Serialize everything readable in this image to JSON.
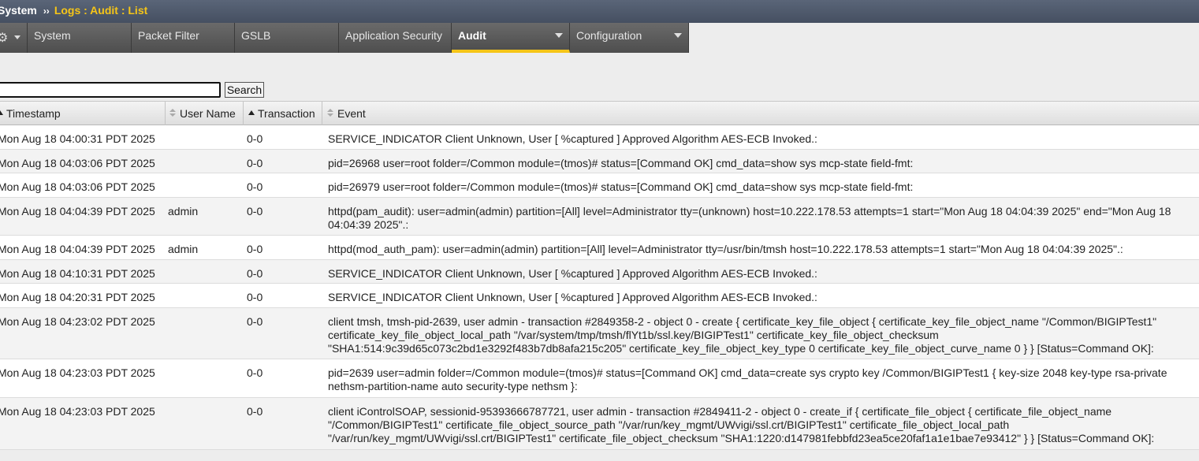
{
  "breadcrumb": {
    "root": "System",
    "separator": "››",
    "current": "Logs : Audit : List"
  },
  "tabs": [
    {
      "label": "System"
    },
    {
      "label": "Packet Filter"
    },
    {
      "label": "GSLB"
    },
    {
      "label": "Application Security"
    },
    {
      "label": "Audit"
    },
    {
      "label": "Configuration"
    }
  ],
  "icons": {
    "settings": "gear-icon",
    "sort": "sort-icon",
    "dropdown": "chevron-down-icon"
  },
  "colors": {
    "accent": "#f5c518",
    "breadcrumb_bg": "#4b5567",
    "tab_bg": "#5a5a5a"
  },
  "search": {
    "value": "",
    "button_label": "Search"
  },
  "table": {
    "columns": [
      "Timestamp",
      "User Name",
      "Transaction",
      "Event"
    ],
    "rows": [
      {
        "timestamp": "Mon Aug 18 04:00:31 PDT 2025",
        "user": "",
        "transaction": "0-0",
        "event": "SERVICE_INDICATOR Client Unknown, User [ %captured ] Approved Algorithm AES-ECB Invoked.:"
      },
      {
        "timestamp": "Mon Aug 18 04:03:06 PDT 2025",
        "user": "",
        "transaction": "0-0",
        "event": "pid=26968 user=root folder=/Common module=(tmos)# status=[Command OK] cmd_data=show sys mcp-state field-fmt:"
      },
      {
        "timestamp": "Mon Aug 18 04:03:06 PDT 2025",
        "user": "",
        "transaction": "0-0",
        "event": "pid=26979 user=root folder=/Common module=(tmos)# status=[Command OK] cmd_data=show sys mcp-state field-fmt:"
      },
      {
        "timestamp": "Mon Aug 18 04:04:39 PDT 2025",
        "user": "admin",
        "transaction": "0-0",
        "event": "httpd(pam_audit): user=admin(admin) partition=[All] level=Administrator tty=(unknown) host=10.222.178.53 attempts=1 start=\"Mon Aug 18 04:04:39 2025\" end=\"Mon Aug 18 04:04:39 2025\".:"
      },
      {
        "timestamp": "Mon Aug 18 04:04:39 PDT 2025",
        "user": "admin",
        "transaction": "0-0",
        "event": "httpd(mod_auth_pam): user=admin(admin) partition=[All] level=Administrator tty=/usr/bin/tmsh host=10.222.178.53 attempts=1 start=\"Mon Aug 18 04:04:39 2025\".:"
      },
      {
        "timestamp": "Mon Aug 18 04:10:31 PDT 2025",
        "user": "",
        "transaction": "0-0",
        "event": "SERVICE_INDICATOR Client Unknown, User [ %captured ] Approved Algorithm AES-ECB Invoked.:"
      },
      {
        "timestamp": "Mon Aug 18 04:20:31 PDT 2025",
        "user": "",
        "transaction": "0-0",
        "event": "SERVICE_INDICATOR Client Unknown, User [ %captured ] Approved Algorithm AES-ECB Invoked.:"
      },
      {
        "timestamp": "Mon Aug 18 04:23:02 PDT 2025",
        "user": "",
        "transaction": "0-0",
        "event": "client tmsh, tmsh-pid-2639, user admin - transaction #2849358-2 - object 0 - create { certificate_key_file_object { certificate_key_file_object_name \"/Common/BIGIPTest1\" certificate_key_file_object_local_path \"/var/system/tmp/tmsh/flYt1b/ssl.key/BIGIPTest1\" certificate_key_file_object_checksum \"SHA1:514:9c39d65c073c2bd1e3292f483b7db8afa215c205\" certificate_key_file_object_key_type 0 certificate_key_file_object_curve_name 0 } } [Status=Command OK]:"
      },
      {
        "timestamp": "Mon Aug 18 04:23:03 PDT 2025",
        "user": "",
        "transaction": "0-0",
        "event": "pid=2639 user=admin folder=/Common module=(tmos)# status=[Command OK] cmd_data=create sys crypto key /Common/BIGIPTest1 { key-size 2048 key-type rsa-private nethsm-partition-name auto security-type nethsm }:"
      },
      {
        "timestamp": "Mon Aug 18 04:23:03 PDT 2025",
        "user": "",
        "transaction": "0-0",
        "event": "client iControlSOAP, sessionid-95393666787721, user admin - transaction #2849411-2 - object 0 - create_if { certificate_file_object { certificate_file_object_name \"/Common/BIGIPTest1\" certificate_file_object_source_path \"/var/run/key_mgmt/UWvigi/ssl.crt/BIGIPTest1\" certificate_file_object_local_path \"/var/run/key_mgmt/UWvigi/ssl.crt/BIGIPTest1\" certificate_file_object_checksum \"SHA1:1220:d147981febbfd23ea5ce20faf1a1e1bae7e93412\" } } [Status=Command OK]:"
      }
    ]
  }
}
